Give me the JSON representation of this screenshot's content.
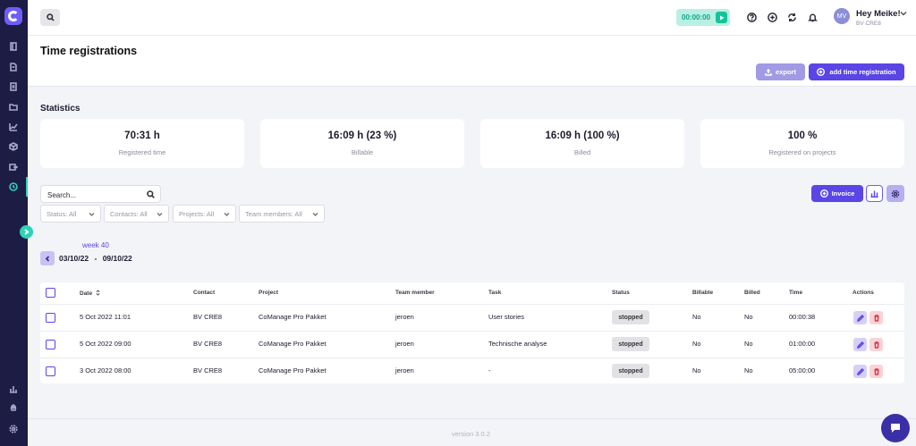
{
  "user": {
    "greeting": "Hey Meike!",
    "initials": "MV",
    "company": "BV CRE8"
  },
  "timer": {
    "value": "00:00:00"
  },
  "page": {
    "title": "Time registrations",
    "export_label": "export",
    "add_label": "add time registration"
  },
  "statistics": {
    "title": "Statistics",
    "cards": [
      {
        "value": "70:31 h",
        "label": "Registered time"
      },
      {
        "value": "16:09 h (23 %)",
        "label": "Billable"
      },
      {
        "value": "16:09 h (100 %)",
        "label": "Billed"
      },
      {
        "value": "100 %",
        "label": "Registered on projects"
      }
    ]
  },
  "search": {
    "placeholder": "Search..."
  },
  "filters": [
    "Status: All",
    "Contacts: All",
    "Projects: All",
    "Team members: All"
  ],
  "invoice_label": "Invoice",
  "week": {
    "label": "week 40",
    "start": "03/10/22",
    "separator": "-",
    "end": "09/10/22"
  },
  "table": {
    "headers": [
      "Date",
      "Contact",
      "Project",
      "Team member",
      "Task",
      "Status",
      "Billable",
      "Billed",
      "Time",
      "Actions"
    ],
    "sort_icon": "sort-icon",
    "rows": [
      {
        "date": "5 Oct 2022 11:01",
        "contact": "BV CRE8",
        "project": "CoManage Pro Pakket",
        "member": "jeroen",
        "task": "User stories",
        "status": "stopped",
        "billable": "No",
        "billed": "No",
        "time": "00:00:38"
      },
      {
        "date": "5 Oct 2022 09:00",
        "contact": "BV CRE8",
        "project": "CoManage Pro Pakket",
        "member": "jeroen",
        "task": "Technische analyse",
        "status": "stopped",
        "billable": "No",
        "billed": "No",
        "time": "01:00:00"
      },
      {
        "date": "3 Oct 2022 08:00",
        "contact": "BV CRE8",
        "project": "CoManage Pro Pakket",
        "member": "jeroen",
        "task": "-",
        "status": "stopped",
        "billable": "No",
        "billed": "No",
        "time": "05:00:00"
      }
    ]
  },
  "footer": {
    "version": "version 3.0.2"
  },
  "colors": {
    "brand": "#5b45e6",
    "sidebar": "#1d1c45",
    "accent": "#2ed3b7"
  }
}
